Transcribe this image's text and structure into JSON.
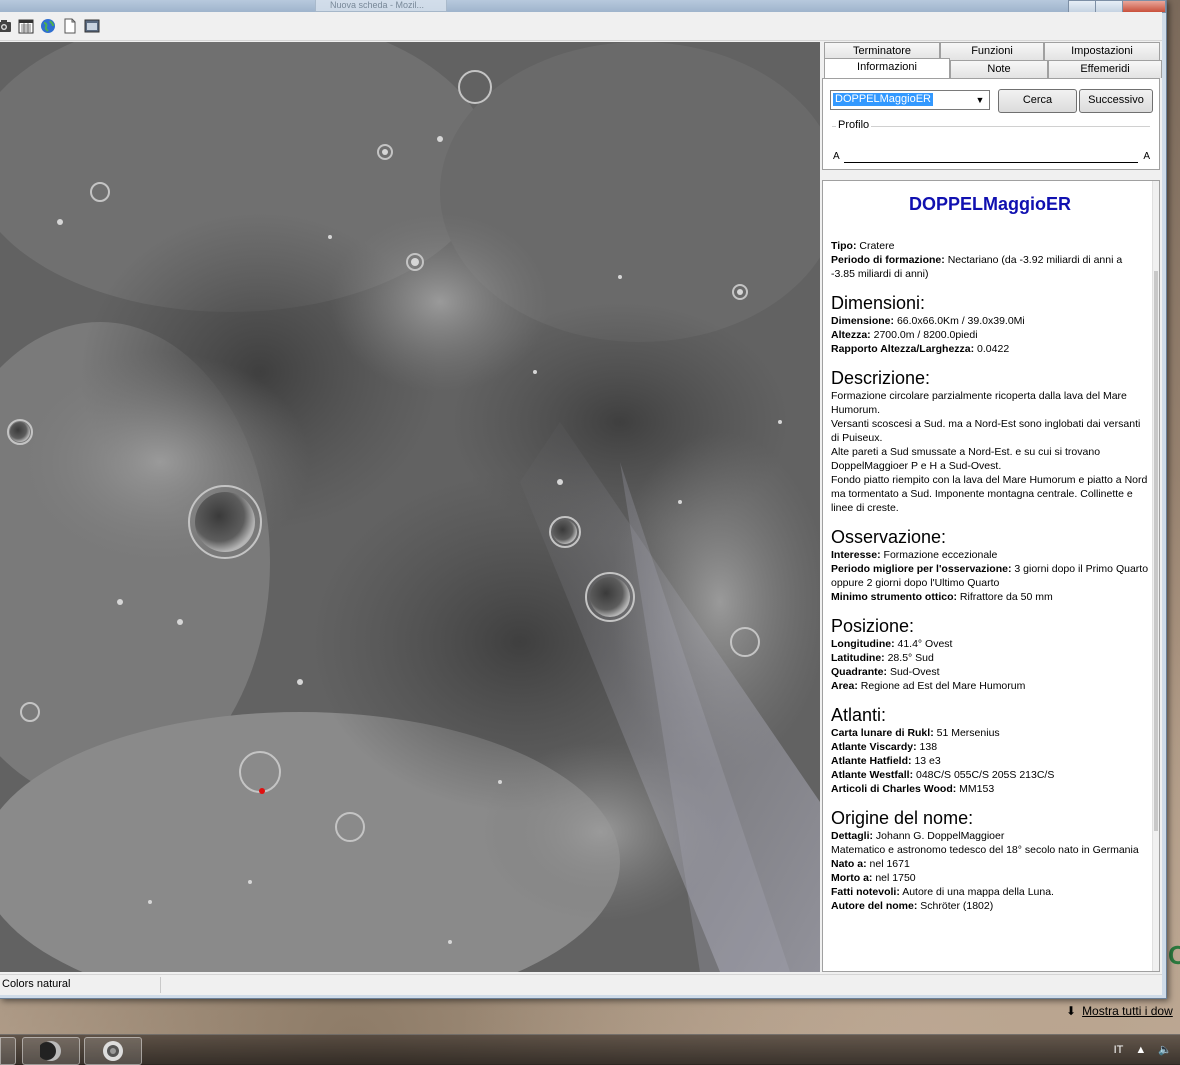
{
  "titlebar": {
    "ghost_tab_text": "Nuova scheda - Mozil..."
  },
  "toolbar": {
    "icons": [
      "camera-icon",
      "calendar-icon",
      "globe-icon",
      "page-icon",
      "window-icon"
    ]
  },
  "tabs": {
    "row1": [
      "Terminatore",
      "Funzioni",
      "Impostazioni"
    ],
    "row2": [
      "Informazioni",
      "Note",
      "Effemeridi"
    ],
    "active": "Informazioni"
  },
  "search": {
    "combo_value": "DOPPELMaggioER",
    "search_button": "Cerca",
    "next_button": "Successivo"
  },
  "profile": {
    "legend": "Profilo",
    "left_label": "A",
    "right_label": "A"
  },
  "info": {
    "title": "DOPPELMaggioER",
    "tipo_label": "Tipo:",
    "tipo_value": "Cratere",
    "periodo_label": "Periodo di formazione:",
    "periodo_value": "Nectariano (da -3.92 miliardi di anni a -3.85 miliardi di anni)",
    "dimensioni_heading": "Dimensioni:",
    "dimensione_label": "Dimensione:",
    "dimensione_value": "66.0x66.0Km / 39.0x39.0Mi",
    "altezza_label": "Altezza:",
    "altezza_value": "2700.0m / 8200.0piedi",
    "rapporto_label": "Rapporto Altezza/Larghezza:",
    "rapporto_value": "0.0422",
    "descrizione_heading": "Descrizione:",
    "descrizione_lines": [
      "Formazione circolare parzialmente ricoperta dalla lava del Mare Humorum.",
      "Versanti scoscesi a Sud. ma a Nord-Est sono inglobati dai versanti di Puiseux.",
      "Alte pareti a Sud smussate a Nord-Est. e su cui si trovano DoppelMaggioer P e H a Sud-Ovest.",
      "Fondo piatto riempito con la lava del Mare Humorum e piatto a Nord ma tormentato a Sud. Imponente montagna centrale. Collinette e linee di creste."
    ],
    "osservazione_heading": "Osservazione:",
    "interesse_label": "Interesse:",
    "interesse_value": "Formazione eccezionale",
    "periodo_oss_label": "Periodo migliore per l'osservazione:",
    "periodo_oss_value": "3 giorni dopo il Primo Quarto oppure 2 giorni dopo l'Ultimo Quarto",
    "strumento_label": "Minimo strumento ottico:",
    "strumento_value": "Rifrattore da 50 mm",
    "posizione_heading": "Posizione:",
    "longitudine_label": "Longitudine:",
    "longitudine_value": "41.4° Ovest",
    "latitudine_label": "Latitudine:",
    "latitudine_value": "28.5° Sud",
    "quadrante_label": "Quadrante:",
    "quadrante_value": "Sud-Ovest",
    "area_label": "Area:",
    "area_value": "Regione ad Est del Mare Humorum",
    "atlanti_heading": "Atlanti:",
    "rukl_label": "Carta lunare di Rukl:",
    "rukl_value": "51 Mersenius",
    "viscardy_label": "Atlante Viscardy:",
    "viscardy_value": "138",
    "hatfield_label": "Atlante Hatfield:",
    "hatfield_value": "13 e3",
    "westfall_label": "Atlante Westfall:",
    "westfall_value": "048C/S 055C/S 205S 213C/S",
    "wood_label": "Articoli di Charles Wood:",
    "wood_value": "MM153",
    "origine_heading": "Origine del nome:",
    "dettagli_label": "Dettagli:",
    "dettagli_value": "Johann G. DoppelMaggioer",
    "dettagli_line2": "Matematico e astronomo tedesco del 18° secolo nato in Germania",
    "nato_label": "Nato a:",
    "nato_value": " nel 1671",
    "morto_label": "Morto a:",
    "morto_value": " nel 1750",
    "fatti_label": "Fatti notevoli:",
    "fatti_value": "Autore di una mappa della Luna.",
    "autore_label": "Autore del nome:",
    "autore_value": "Schröter (1802)"
  },
  "status": {
    "text": "Colors natural"
  },
  "desktop": {
    "show_all": "Mostra tutti i dow"
  },
  "tray": {
    "language": "IT"
  },
  "colors": {
    "title_blue": "#1010b0",
    "selection": "#3399ff",
    "marker_red": "#e01010"
  }
}
